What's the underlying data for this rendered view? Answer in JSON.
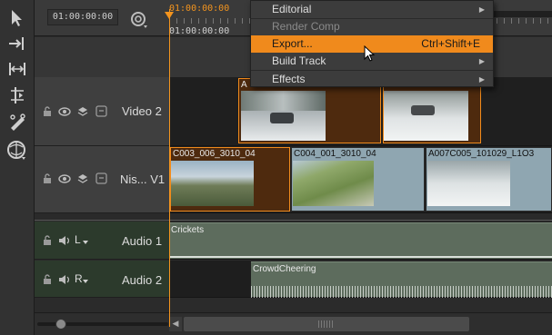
{
  "header": {
    "timecode": "01:00:00:00",
    "ruler_timecode_top": "01:00:00:00",
    "ruler_timecode_bottom": "01:00:00:00"
  },
  "tracks": [
    {
      "id": "video2",
      "name": "Video 2"
    },
    {
      "id": "video1",
      "name": "Nis... V1"
    },
    {
      "id": "audio1",
      "name": "Audio 1",
      "channel": "L"
    },
    {
      "id": "audio2",
      "name": "Audio 2",
      "channel": "R"
    }
  ],
  "clips": {
    "video2_a": "A",
    "v1_a": "C003_006_3010_04",
    "v1_b": "C004_001_3010_04",
    "v1_c": "A007C005_101029_L1O3",
    "audio1": "Crickets",
    "audio2": "CrowdCheering"
  },
  "menu": {
    "items": [
      {
        "label": "Editorial",
        "submenu": true
      },
      {
        "label": "Render Comp",
        "disabled": true
      },
      {
        "label": "Export...",
        "shortcut": "Ctrl+Shift+E",
        "highlighted": true
      },
      {
        "label": "Build Track",
        "submenu": true
      },
      {
        "label": "Effects",
        "submenu": true
      }
    ]
  },
  "colors": {
    "accent": "#f08a1c",
    "playhead": "#f3941e",
    "video_track_bg": "#3f3f3f",
    "audio_track_bg": "#2c3a2c",
    "audio_clip": "#5d6c5d",
    "selected_clip": "#4e2a0e"
  }
}
